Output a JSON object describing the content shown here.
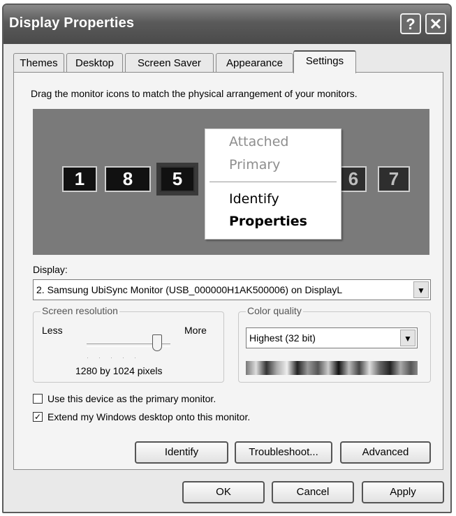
{
  "window": {
    "title": "Display Properties",
    "help_label": "?",
    "close_label": "✕"
  },
  "tabs": [
    {
      "label": "Themes"
    },
    {
      "label": "Desktop"
    },
    {
      "label": "Screen Saver"
    },
    {
      "label": "Appearance"
    },
    {
      "label": "Settings",
      "active": true
    }
  ],
  "settings": {
    "instruction": "Drag the monitor icons to match the physical arrangement of your monitors.",
    "monitors": [
      "1",
      "8",
      "5",
      "6",
      "7"
    ],
    "context_menu": {
      "items": [
        {
          "label": "Attached",
          "state": "disabled"
        },
        {
          "label": "Primary",
          "state": "disabled"
        },
        {
          "label": "Identify",
          "state": "normal"
        },
        {
          "label": "Properties",
          "state": "default"
        }
      ]
    },
    "display_label": "Display:",
    "display_value": "2. Samsung UbiSync Monitor (USB_000000H1AK500006) on DisplayL",
    "screen_resolution": {
      "group_label": "Screen resolution",
      "less_label": "Less",
      "more_label": "More",
      "value_text": "1280 by 1024 pixels",
      "slider_level": 0.85
    },
    "color_quality": {
      "group_label": "Color quality",
      "selected": "Highest (32 bit)"
    },
    "primary_checkbox": {
      "label": "Use this device as the primary monitor.",
      "checked": false
    },
    "extend_checkbox": {
      "label": "Extend my Windows desktop onto this monitor.",
      "checked": true
    },
    "buttons": {
      "identify": "Identify",
      "troubleshoot": "Troubleshoot...",
      "advanced": "Advanced"
    }
  },
  "footer": {
    "ok": "OK",
    "cancel": "Cancel",
    "apply": "Apply"
  }
}
